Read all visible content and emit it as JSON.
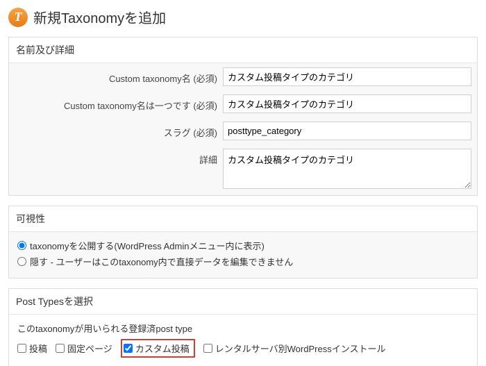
{
  "header": {
    "icon_letter": "T",
    "title": "新規Taxonomyを追加"
  },
  "section_name": {
    "title": "名前及び詳細",
    "rows": {
      "name": {
        "label": "Custom taxonomy名",
        "req": "(必須)",
        "value": "カスタム投稿タイプのカテゴリ"
      },
      "singular": {
        "label": "Custom taxonomy名は一つです",
        "req": "(必須)",
        "value": "カスタム投稿タイプのカテゴリ"
      },
      "slug": {
        "label": "スラグ",
        "req": "(必須)",
        "value": "posttype_category"
      },
      "desc": {
        "label": "詳細",
        "value": "カスタム投稿タイプのカテゴリ"
      }
    }
  },
  "section_visibility": {
    "title": "可視性",
    "option_public": "taxonomyを公開する(WordPress Adminメニュー内に表示)",
    "option_hidden": "隠す - ユーザーはこのtaxonomy内で直接データを編集できません"
  },
  "section_posttypes": {
    "title": "Post Typesを選択",
    "help": "このtaxonomyが用いられる登録済post type",
    "items": {
      "post": "投稿",
      "page": "固定ページ",
      "custom": "カスタム投稿",
      "server": "レンタルサーバ別WordPressインストール"
    }
  }
}
